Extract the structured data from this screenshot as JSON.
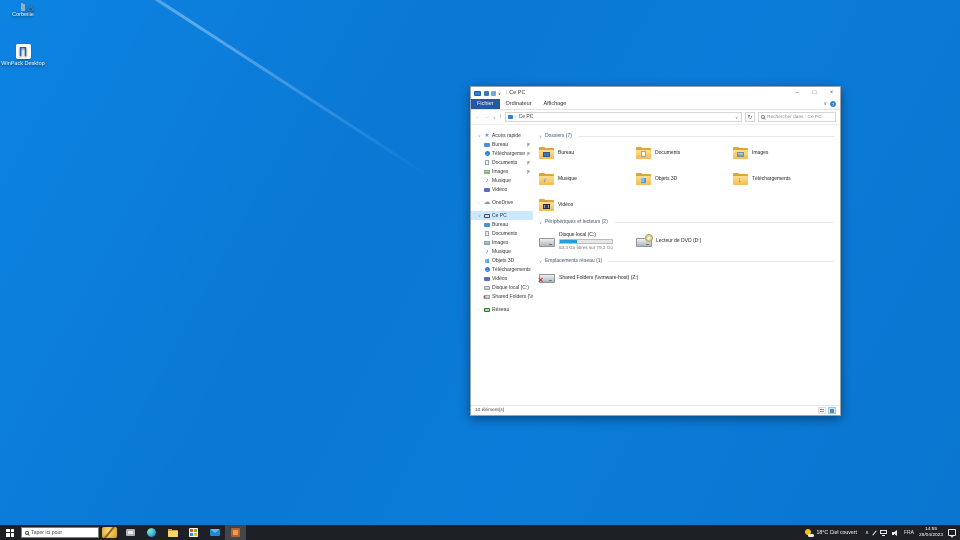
{
  "colors": {
    "desktop_blue": "#0b7bd8",
    "taskbar": "#1d2125",
    "selection": "#cce8ff",
    "file_tab": "#2457a4",
    "drive_bar_fill": "#26a0da",
    "folder_yellow": "#ffd464"
  },
  "desktop": {
    "icons": [
      {
        "label": "Corbeille"
      },
      {
        "label": "WinPack Desktop"
      }
    ]
  },
  "explorer": {
    "title": "Ce PC",
    "ribbon": {
      "tabs": [
        "Fichier",
        "Ordinateur",
        "Affichage"
      ]
    },
    "address": {
      "breadcrumb": "Ce PC",
      "search_placeholder": "Rechercher dans : Ce PC"
    },
    "sidebar": {
      "quick_access": {
        "label": "Accès rapide",
        "items": [
          {
            "label": "Bureau",
            "pinned": true
          },
          {
            "label": "Téléchargements",
            "pinned": true
          },
          {
            "label": "Documents",
            "pinned": true
          },
          {
            "label": "Images",
            "pinned": true
          },
          {
            "label": "Musique",
            "pinned": false
          },
          {
            "label": "Vidéos",
            "pinned": false
          }
        ]
      },
      "onedrive": {
        "label": "OneDrive"
      },
      "this_pc": {
        "label": "Ce PC",
        "items": [
          {
            "label": "Bureau"
          },
          {
            "label": "Documents"
          },
          {
            "label": "Images"
          },
          {
            "label": "Musique"
          },
          {
            "label": "Objets 3D"
          },
          {
            "label": "Téléchargements"
          },
          {
            "label": "Vidéos"
          },
          {
            "label": "Disque local (C:)"
          },
          {
            "label": "Shared Folders (\\\\vm"
          }
        ]
      },
      "network": {
        "label": "Réseau"
      }
    },
    "content": {
      "groups": [
        {
          "title": "Dossiers (7)"
        },
        {
          "title": "Périphériques et lecteurs (2)"
        },
        {
          "title": "Emplacements réseau (1)"
        }
      ],
      "folders": [
        "Bureau",
        "Documents",
        "Images",
        "Musique",
        "Objets 3D",
        "Téléchargements",
        "Vidéos"
      ],
      "drives": [
        {
          "name": "Disque local (C:)",
          "free_text": "53,3 Go libres sur 79,3 Go",
          "used_percent": 33
        },
        {
          "name": "Lecteur de DVD (D:)"
        }
      ],
      "network_items": [
        {
          "name": "Shared Folders (\\\\vmware-host) (Z:)"
        }
      ]
    },
    "status": "10 élément(s)"
  },
  "taskbar": {
    "search_placeholder": "Taper ici pour",
    "tray": {
      "weather": "18°C Ciel couvert",
      "language": "FRA",
      "time": "14:55",
      "date": "28/04/2023"
    }
  },
  "icons": {
    "minimize": "–",
    "maximize": "□",
    "close": "×",
    "back": "←",
    "forward": "→",
    "up": "↑",
    "dropdown": "∨",
    "refresh": "↻",
    "crumb_sep": "›",
    "help": "?",
    "star": "★",
    "cloud": "☁",
    "music_note": "♪",
    "down_arrow": "↓",
    "recycle": "♻",
    "caret_up": "∧",
    "group_chevron": "∨",
    "branch_expanded": "∨",
    "branch_collapsed": "›",
    "app_glyph": "∏"
  }
}
